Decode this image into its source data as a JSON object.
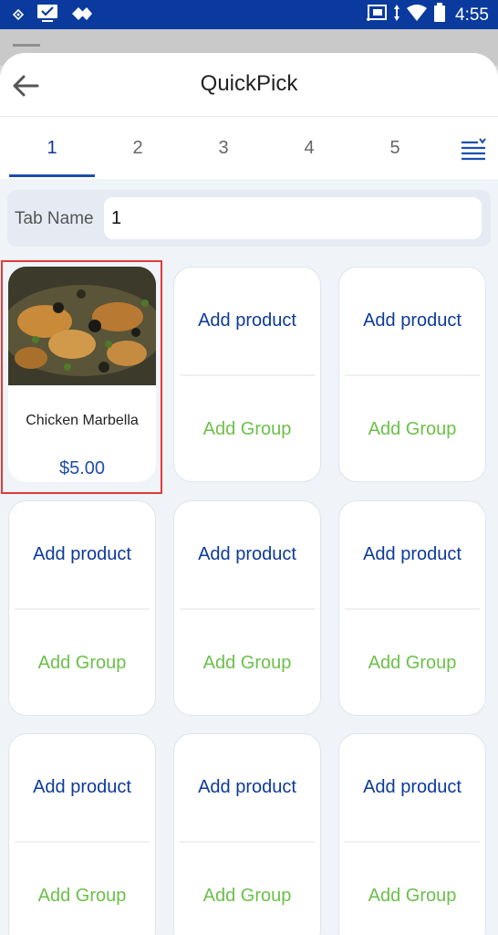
{
  "status_bar": {
    "time": "4:55",
    "icons": [
      "notification-icon",
      "monitor-icon",
      "tag-icon",
      "cast-icon",
      "data-arrows-icon",
      "wifi-icon",
      "battery-icon"
    ]
  },
  "header": {
    "title": "QuickPick"
  },
  "tabs": [
    {
      "label": "1",
      "active": true
    },
    {
      "label": "2",
      "active": false
    },
    {
      "label": "3",
      "active": false
    },
    {
      "label": "4",
      "active": false
    },
    {
      "label": "5",
      "active": false
    }
  ],
  "tab_name": {
    "label": "Tab Name",
    "value": "1"
  },
  "product": {
    "name": "Chicken Marbella",
    "price": "$5.00"
  },
  "empty_slot": {
    "add_product": "Add product",
    "add_group": "Add Group"
  },
  "colors": {
    "status_bar": "#0a3a9e",
    "primary_text": "#0d3a99",
    "group_green": "#6cc04a",
    "selected_outline": "#e23b3b"
  }
}
